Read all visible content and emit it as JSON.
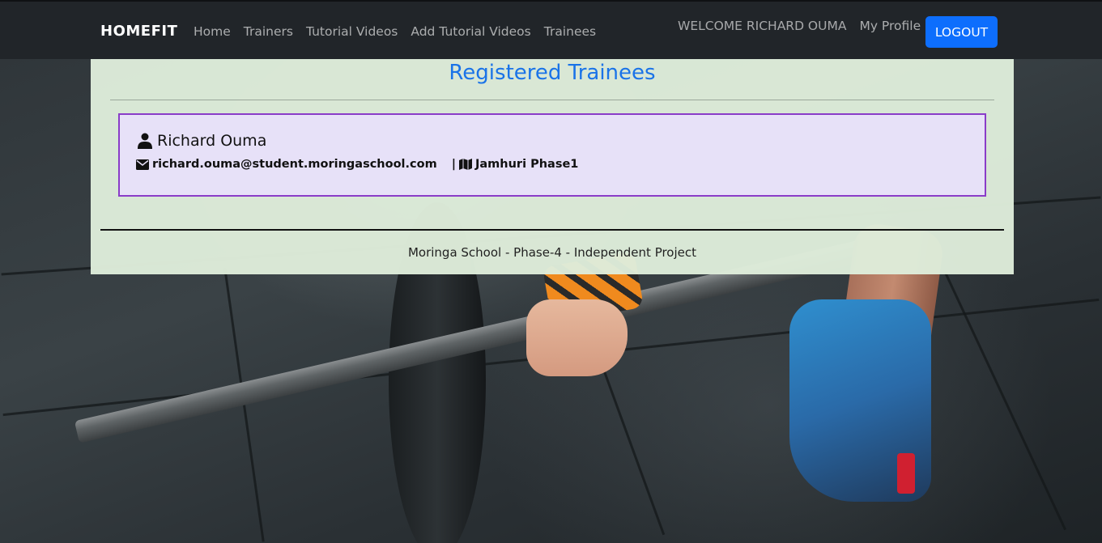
{
  "navbar": {
    "brand": "HOMEFIT",
    "links": [
      "Home",
      "Trainers",
      "Tutorial Videos",
      "Add Tutorial Videos",
      "Trainees"
    ],
    "welcome": "WELCOME RICHARD OUMA",
    "profile_label": "My Profile",
    "logout_label": "LOGOUT"
  },
  "main": {
    "title": "Registered Trainees",
    "trainees": [
      {
        "name": "Richard Ouma",
        "email": "richard.ouma@student.moringaschool.com",
        "separator": "|",
        "location": "Jamhuri Phase1"
      }
    ],
    "footer": "Moringa School - Phase-4 - Independent Project"
  },
  "icons": {
    "name_icon": "user-icon",
    "email_icon": "envelope-icon",
    "location_icon": "map-icon"
  },
  "colors": {
    "navbar_bg": "#212529",
    "logout_bg": "#0d6efd",
    "title": "#1a73e8",
    "card_bg": "#e7e1f8",
    "card_border": "#8a3cc8",
    "panel_bg": "#deecda"
  }
}
